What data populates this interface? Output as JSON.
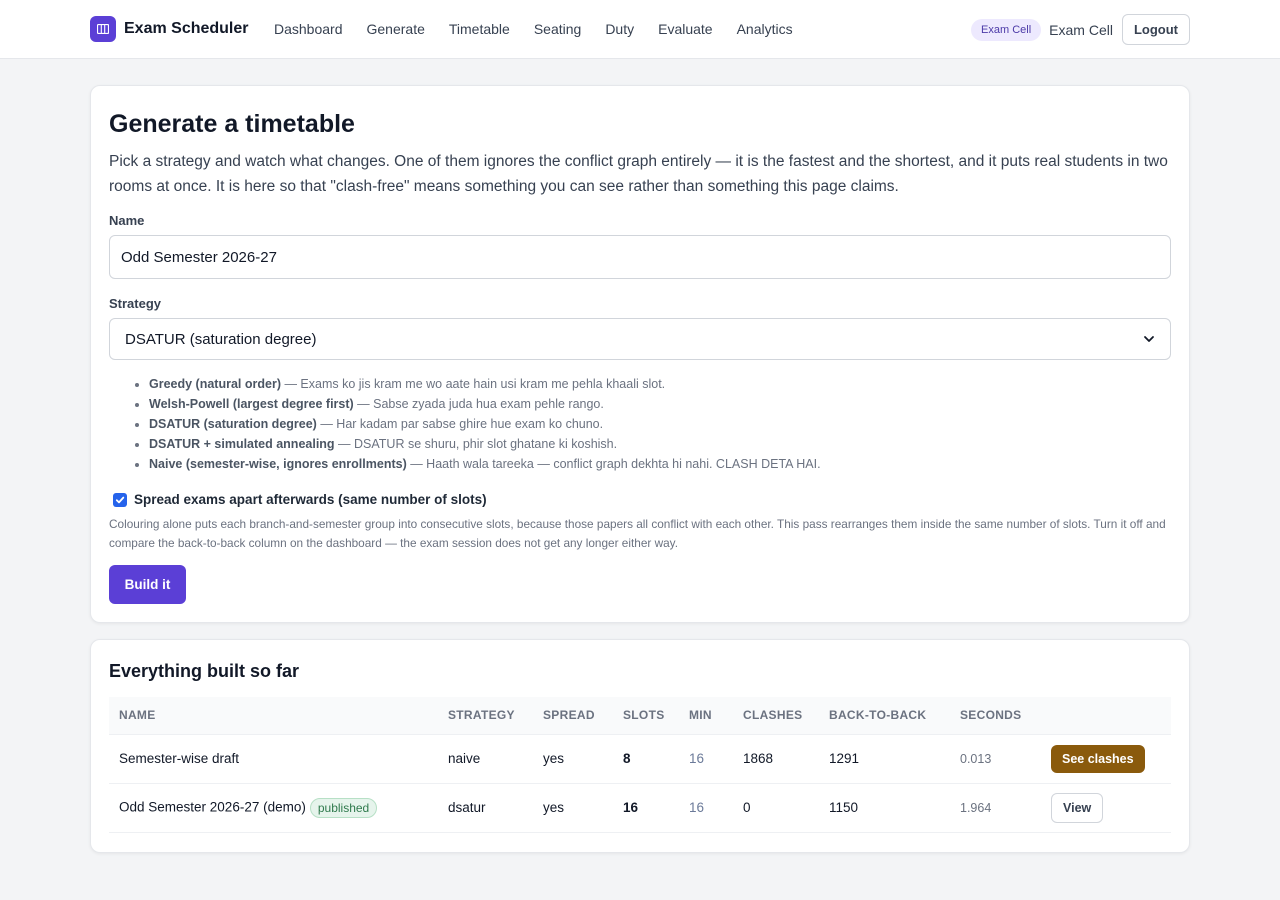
{
  "colors": {
    "accent": "#5b3fd6",
    "warning_button": "#8a5a0c",
    "published_badge": "#2f7a4d"
  },
  "header": {
    "app_title": "Exam Scheduler",
    "logo_icon": "calendar-columns-icon",
    "nav": [
      "Dashboard",
      "Generate",
      "Timetable",
      "Seating",
      "Duty",
      "Evaluate",
      "Analytics"
    ],
    "role_badge": "Exam Cell",
    "user_name": "Exam Cell",
    "logout_label": "Logout"
  },
  "generate": {
    "title": "Generate a timetable",
    "description": "Pick a strategy and watch what changes. One of them ignores the conflict graph entirely — it is the fastest and the shortest, and it puts real students in two rooms at once. It is here so that \"clash-free\" means something you can see rather than something this page claims.",
    "name_label": "Name",
    "name_value": "Odd Semester 2026-27",
    "strategy_label": "Strategy",
    "strategy_selected": "DSATUR (saturation degree)",
    "strategies": [
      {
        "name": "Greedy (natural order)",
        "desc": " — Exams ko jis kram me wo aate hain usi kram me pehla khaali slot."
      },
      {
        "name": "Welsh-Powell (largest degree first)",
        "desc": " — Sabse zyada juda hua exam pehle rango."
      },
      {
        "name": "DSATUR (saturation degree)",
        "desc": " — Har kadam par sabse ghire hue exam ko chuno."
      },
      {
        "name": "DSATUR + simulated annealing",
        "desc": " — DSATUR se shuru, phir slot ghatane ki koshish."
      },
      {
        "name": "Naive (semester-wise, ignores enrollments)",
        "desc": " — Haath wala tareeka — conflict graph dekhta hi nahi. CLASH DETA HAI."
      }
    ],
    "spread_checked": true,
    "spread_label": "Spread exams apart afterwards (same number of slots)",
    "spread_help": "Colouring alone puts each branch-and-semester group into consecutive slots, because those papers all conflict with each other. This pass rearranges them inside the same number of slots. Turn it off and compare the back-to-back column on the dashboard — the exam session does not get any longer either way.",
    "build_label": "Build it"
  },
  "runs": {
    "title": "Everything built so far",
    "columns": [
      "NAME",
      "STRATEGY",
      "SPREAD",
      "SLOTS",
      "MIN",
      "CLASHES",
      "BACK-TO-BACK",
      "SECONDS"
    ],
    "rows": [
      {
        "name": "Semester-wise draft",
        "badge": "",
        "strategy": "naive",
        "spread": "yes",
        "slots": "8",
        "min": "16",
        "clashes": "1868",
        "back_to_back": "1291",
        "seconds": "0.013",
        "action": "See clashes"
      },
      {
        "name": "Odd Semester 2026-27 (demo)",
        "badge": "published",
        "strategy": "dsatur",
        "spread": "yes",
        "slots": "16",
        "min": "16",
        "clashes": "0",
        "back_to_back": "1150",
        "seconds": "1.964",
        "action": "View"
      }
    ]
  }
}
